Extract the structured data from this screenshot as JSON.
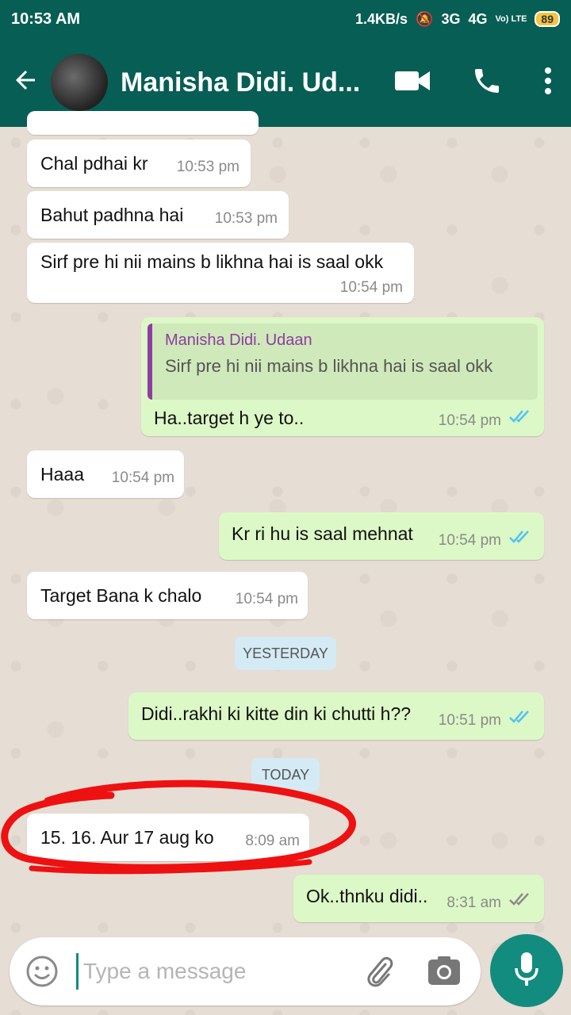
{
  "status": {
    "time": "10:53 AM",
    "speed": "1.4KB/s",
    "net1": "3G",
    "net2": "4G",
    "volte": "Vo) LTE",
    "battery": "89"
  },
  "header": {
    "contact_name": "Manisha Didi. Ud..."
  },
  "messages": [
    {
      "text": "Chal pdhai kr",
      "time": "10:53 pm"
    },
    {
      "text": "Bahut padhna hai",
      "time": "10:53 pm"
    },
    {
      "text": "Sirf pre hi nii mains b likhna hai is saal okk",
      "time": "10:54 pm"
    },
    {
      "text": "Ha..target h ye to..",
      "time": "10:54 pm",
      "quote_name": "Manisha Didi. Udaan",
      "quote_text": "Sirf pre hi nii mains b likhna hai is saal okk"
    },
    {
      "text": "Haaa",
      "time": "10:54 pm"
    },
    {
      "text": "Kr ri hu is saal mehnat",
      "time": "10:54 pm"
    },
    {
      "text": "Target Bana k chalo",
      "time": "10:54 pm"
    },
    {
      "text": "Didi..rakhi ki kitte din ki chutti h??",
      "time": "10:51 pm"
    },
    {
      "text": "15. 16. Aur 17 aug ko",
      "time": "8:09 am"
    },
    {
      "text": "Ok..thnku didi..",
      "time": "8:31 am"
    }
  ],
  "dividers": {
    "yesterday": "YESTERDAY",
    "today": "TODAY"
  },
  "composer": {
    "placeholder": "Type a message"
  },
  "colors": {
    "header": "#075e54",
    "outgoing": "#dcf8c6",
    "incoming": "#ffffff",
    "read_ticks": "#4fc3f7",
    "annotation": "#e11"
  }
}
